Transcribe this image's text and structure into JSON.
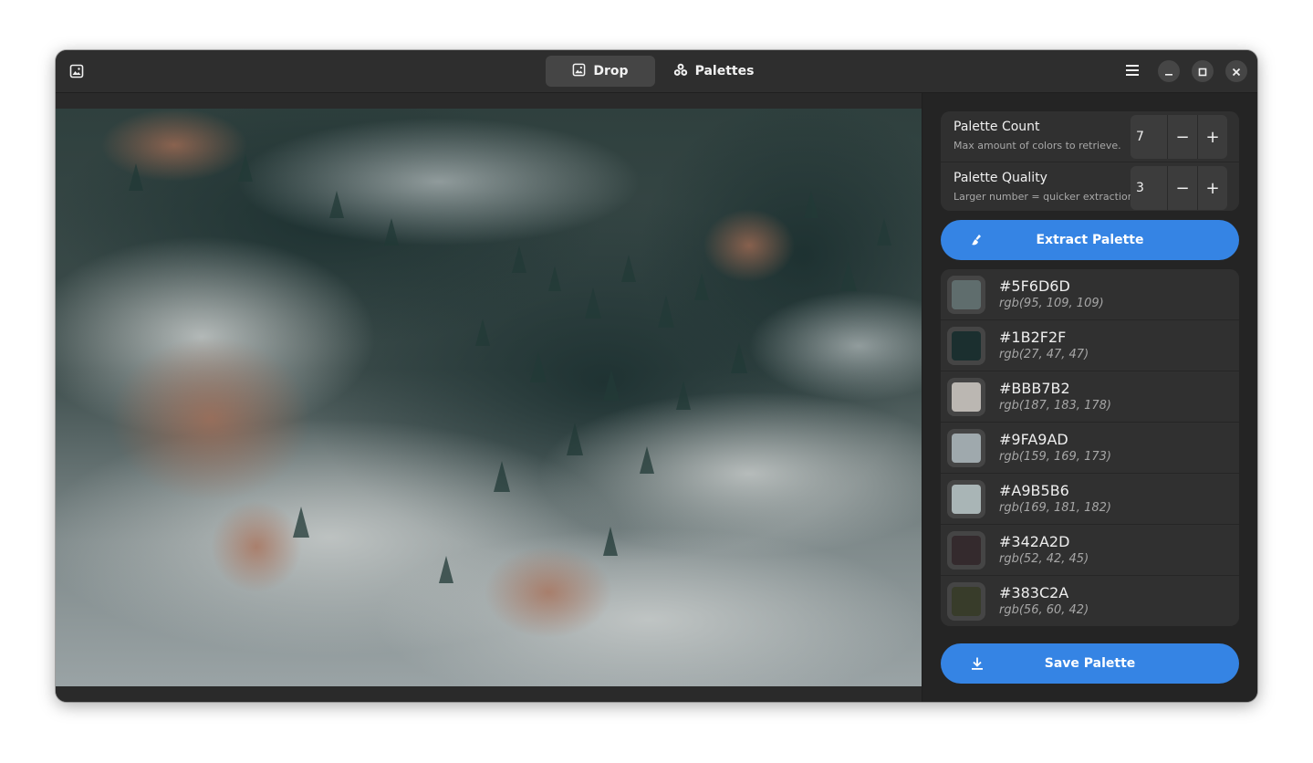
{
  "window": {
    "tabs": [
      {
        "label": "Drop",
        "icon": "image-icon",
        "active": true
      },
      {
        "label": "Palettes",
        "icon": "palette-icon",
        "active": false
      }
    ]
  },
  "settings": {
    "count": {
      "title": "Palette Count",
      "subtitle": "Max amount of colors to retrieve.",
      "value": "7"
    },
    "quality": {
      "title": "Palette Quality",
      "subtitle": "Larger number = quicker extraction.",
      "value": "3"
    }
  },
  "actions": {
    "extract_label": "Extract Palette",
    "save_label": "Save Palette"
  },
  "palette": [
    {
      "hex": "#5F6D6D",
      "rgb": "rgb(95, 109, 109)"
    },
    {
      "hex": "#1B2F2F",
      "rgb": "rgb(27, 47, 47)"
    },
    {
      "hex": "#BBB7B2",
      "rgb": "rgb(187, 183, 178)"
    },
    {
      "hex": "#9FA9AD",
      "rgb": "rgb(159, 169, 173)"
    },
    {
      "hex": "#A9B5B6",
      "rgb": "rgb(169, 181, 182)"
    },
    {
      "hex": "#342A2D",
      "rgb": "rgb(52, 42, 45)"
    },
    {
      "hex": "#383C2A",
      "rgb": "rgb(56, 60, 42)"
    }
  ],
  "colors": {
    "accent": "#3584e4",
    "window_bg": "#242424",
    "header_bg": "#2e2e2e"
  }
}
